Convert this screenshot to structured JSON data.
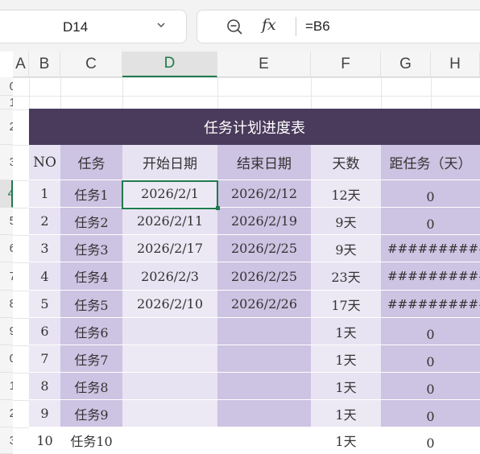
{
  "name_box": "D14",
  "formula": "=B6",
  "colors": {
    "title_bg": "#4a3b5c",
    "light": "#e8e3f2",
    "mid": "#cdc3e2",
    "accent": "#1f7a4d"
  },
  "column_headers": [
    "A",
    "B",
    "C",
    "D",
    "E",
    "F",
    "G",
    "H"
  ],
  "row_numbers": [
    "0",
    "1",
    "2",
    "3",
    "4",
    "5",
    "6",
    "7",
    "8",
    "9",
    "0",
    "1",
    "2",
    "3"
  ],
  "table": {
    "title": "任务计划进度表",
    "headers": [
      "NO",
      "任务",
      "开始日期",
      "结束日期",
      "天数",
      "距任务（天）"
    ],
    "rows": [
      [
        "1",
        "任务1",
        "2026/2/1",
        "2026/2/12",
        "12天",
        "0"
      ],
      [
        "2",
        "任务2",
        "2026/2/11",
        "2026/2/19",
        "9天",
        "0"
      ],
      [
        "3",
        "任务3",
        "2026/2/17",
        "2026/2/25",
        "9天",
        "###########"
      ],
      [
        "4",
        "任务4",
        "2026/2/3",
        "2026/2/25",
        "23天",
        "###########"
      ],
      [
        "5",
        "任务5",
        "2026/2/10",
        "2026/2/26",
        "17天",
        "###########"
      ],
      [
        "6",
        "任务6",
        "",
        "",
        "1天",
        "0"
      ],
      [
        "7",
        "任务7",
        "",
        "",
        "1天",
        "0"
      ],
      [
        "8",
        "任务8",
        "",
        "",
        "1天",
        "0"
      ],
      [
        "9",
        "任务9",
        "",
        "",
        "1天",
        "0"
      ],
      [
        "10",
        "任务10",
        "",
        "",
        "1天",
        "0"
      ]
    ]
  }
}
